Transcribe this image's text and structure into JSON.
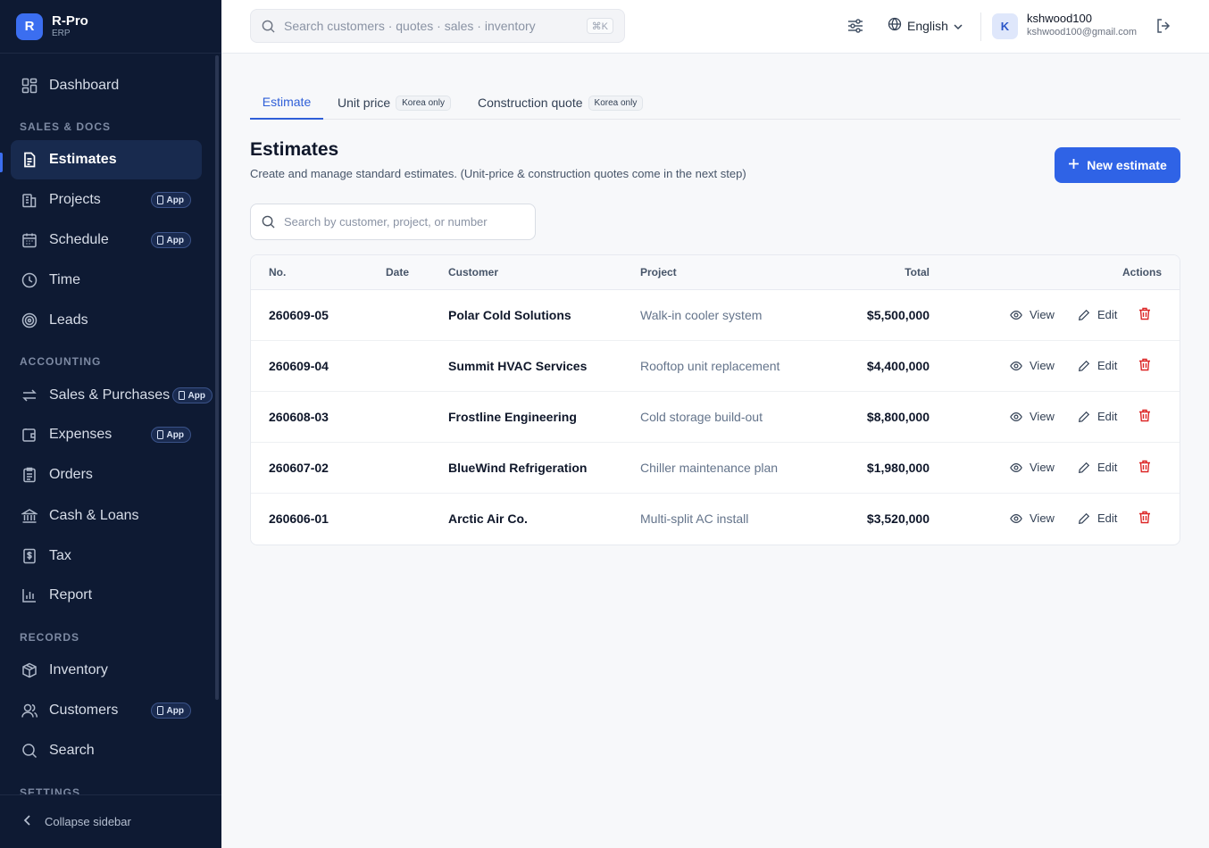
{
  "brand": {
    "logo_letter": "R",
    "name": "R-Pro",
    "sub": "ERP"
  },
  "sidebar": {
    "dashboard": "Dashboard",
    "sections": {
      "sales_docs": "SALES & DOCS",
      "accounting": "ACCOUNTING",
      "records": "RECORDS",
      "settings": "SETTINGS"
    },
    "items": {
      "estimates": "Estimates",
      "projects": "Projects",
      "schedule": "Schedule",
      "time": "Time",
      "leads": "Leads",
      "sales_purchases": "Sales & Purchases",
      "expenses": "Expenses",
      "orders": "Orders",
      "cash_loans": "Cash & Loans",
      "tax": "Tax",
      "report": "Report",
      "inventory": "Inventory",
      "customers": "Customers",
      "search": "Search"
    },
    "app_badge": "App",
    "collapse": "Collapse sidebar"
  },
  "topbar": {
    "search_placeholder": "Search customers · quotes · sales · inventory",
    "shortcut": "⌘K",
    "language": "English",
    "avatar_letter": "K",
    "username": "kshwood100",
    "email": "kshwood100@gmail.com"
  },
  "tabs": {
    "estimate": "Estimate",
    "unit_price": "Unit price",
    "construction": "Construction quote",
    "korea_only": "Korea only"
  },
  "page": {
    "title": "Estimates",
    "subtitle": "Create and manage standard estimates. (Unit-price & construction quotes come in the next step)",
    "new_button": "New estimate",
    "search_placeholder": "Search by customer, project, or number"
  },
  "table": {
    "headers": {
      "no": "No.",
      "date": "Date",
      "customer": "Customer",
      "project": "Project",
      "total": "Total",
      "actions": "Actions"
    },
    "view": "View",
    "edit": "Edit",
    "rows": [
      {
        "no": "260609-05",
        "date": "",
        "customer": "Polar Cold Solutions",
        "project": "Walk-in cooler system",
        "total": "$5,500,000"
      },
      {
        "no": "260609-04",
        "date": "",
        "customer": "Summit HVAC Services",
        "project": "Rooftop unit replacement",
        "total": "$4,400,000"
      },
      {
        "no": "260608-03",
        "date": "",
        "customer": "Frostline Engineering",
        "project": "Cold storage build-out",
        "total": "$8,800,000"
      },
      {
        "no": "260607-02",
        "date": "",
        "customer": "BlueWind Refrigeration",
        "project": "Chiller maintenance plan",
        "total": "$1,980,000"
      },
      {
        "no": "260606-01",
        "date": "",
        "customer": "Arctic Air Co.",
        "project": "Multi-split AC install",
        "total": "$3,520,000"
      }
    ]
  },
  "colors": {
    "accent": "#2f63e6",
    "sidebar_bg": "#0e1a33",
    "danger": "#dc2626"
  }
}
